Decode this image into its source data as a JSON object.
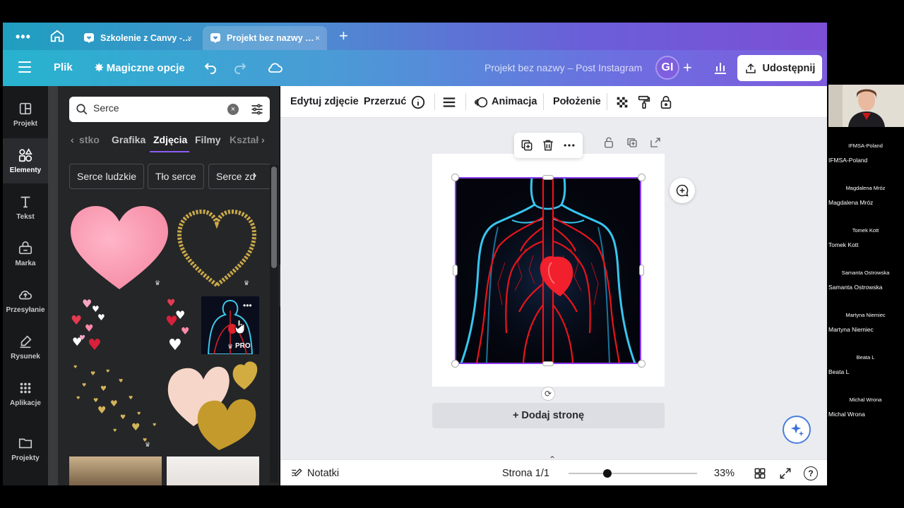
{
  "browser": {
    "tabs": [
      {
        "label": "Szkolenie z Canvy -…",
        "close": "×"
      },
      {
        "label": "Projekt bez nazwy …",
        "close": "×"
      }
    ],
    "menu_dots": "•••",
    "new_tab": "+"
  },
  "header": {
    "file": "Plik",
    "magic": "Magiczne opcje",
    "title": "Projekt bez nazwy – Post Instagram",
    "avatar_initials": "GI",
    "add": "+",
    "share": "Udostępnij"
  },
  "sidebar": {
    "items": [
      {
        "label": "Projekt"
      },
      {
        "label": "Elementy"
      },
      {
        "label": "Tekst"
      },
      {
        "label": "Marka"
      },
      {
        "label": "Przesyłanie"
      },
      {
        "label": "Rysunek"
      },
      {
        "label": "Aplikacje"
      },
      {
        "label": "Projekty"
      }
    ]
  },
  "panel": {
    "search_value": "Serce",
    "categories": [
      "stko",
      "Grafika",
      "Zdjęcia",
      "Filmy",
      "Kształ"
    ],
    "active_category": "Zdjęcia",
    "chips": [
      "Serce ludzkie",
      "Tło serce",
      "Serce zd"
    ],
    "pro_label": "PRO"
  },
  "toolbar": {
    "edit_photo": "Edytuj zdjęcie",
    "flip": "Przerzuć",
    "animation": "Animacja",
    "position": "Położenie"
  },
  "canvas": {
    "add_page": "+ Dodaj stronę"
  },
  "bottombar": {
    "notes": "Notatki",
    "page": "Strona 1/1",
    "zoom": "33%",
    "zoom_level": 0.33,
    "help": "?"
  },
  "gallery": [
    {
      "center": "IFMSA-Poland",
      "name": "IFMSA-Poland"
    },
    {
      "center": "Magdalena Mróz",
      "name": "Magdalena Mróz"
    },
    {
      "center": "Tomek Kott",
      "name": "Tomek Kott"
    },
    {
      "center": "Samanta Ostrowska",
      "name": "Samanta Ostrowska"
    },
    {
      "center": "Martyna Niemiec",
      "name": "Martyna Niemiec"
    },
    {
      "center": "Beata L",
      "name": "Beata L"
    },
    {
      "center": "Michal Wrona",
      "name": "Michal Wrona"
    }
  ],
  "colors": {
    "accent": "#8b3dff",
    "header_start": "#27b3cf",
    "header_end": "#7d5bdc",
    "sidebar_bg": "#18191b",
    "panel_bg": "#252627"
  }
}
